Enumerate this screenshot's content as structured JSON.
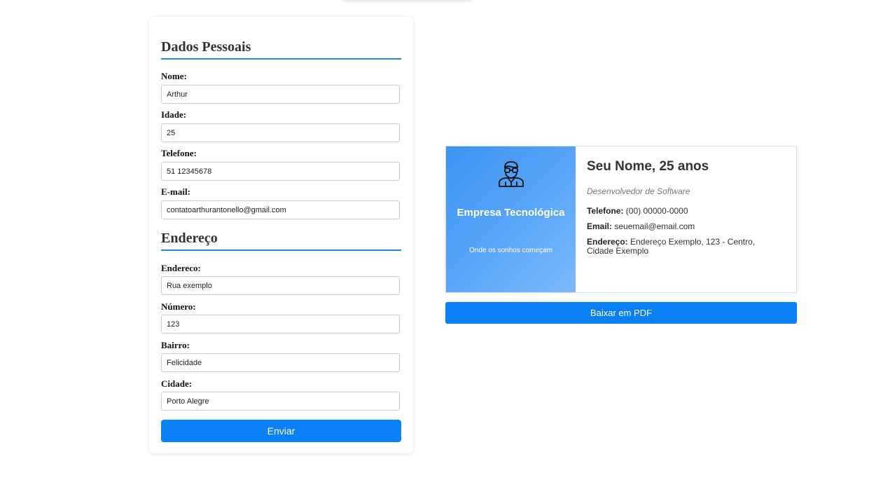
{
  "form": {
    "personal_title": "Dados Pessoais",
    "address_title": "Endereço",
    "fields": {
      "nome": {
        "label": "Nome:",
        "value": "Arthur"
      },
      "idade": {
        "label": "Idade:",
        "value": "25"
      },
      "telefone": {
        "label": "Telefone:",
        "value": "51 12345678"
      },
      "email": {
        "label": "E-mail:",
        "value": "contatoarthurantonello@gmail.com"
      },
      "endereco": {
        "label": "Endereco:",
        "value": "Rua exemplo"
      },
      "numero": {
        "label": "Número:",
        "value": "123"
      },
      "bairro": {
        "label": "Bairro:",
        "value": "Felicidade"
      },
      "cidade": {
        "label": "Cidade:",
        "value": "Porto Alegre"
      }
    },
    "submit_label": "Enviar"
  },
  "card": {
    "company": "Empresa Tecnológica",
    "slogan": "Onde os sonhos começam",
    "icon": "developer-icon",
    "name_age": "Seu Nome, 25 anos",
    "job_title": "Desenvolvedor de Software",
    "phone_label": "Telefone:",
    "phone": "(00) 00000-0000",
    "email_label": "Email:",
    "email": "seuemail@email.com",
    "address_label": "Endereço:",
    "address": "Endereço Exemplo, 123 - Centro, Cidade Exemplo"
  },
  "pdf_button": "Baixar em PDF",
  "colors": {
    "accent": "#0a80f5",
    "card_gradient_start": "#3d94f5",
    "card_gradient_end": "#7cb9fa"
  }
}
